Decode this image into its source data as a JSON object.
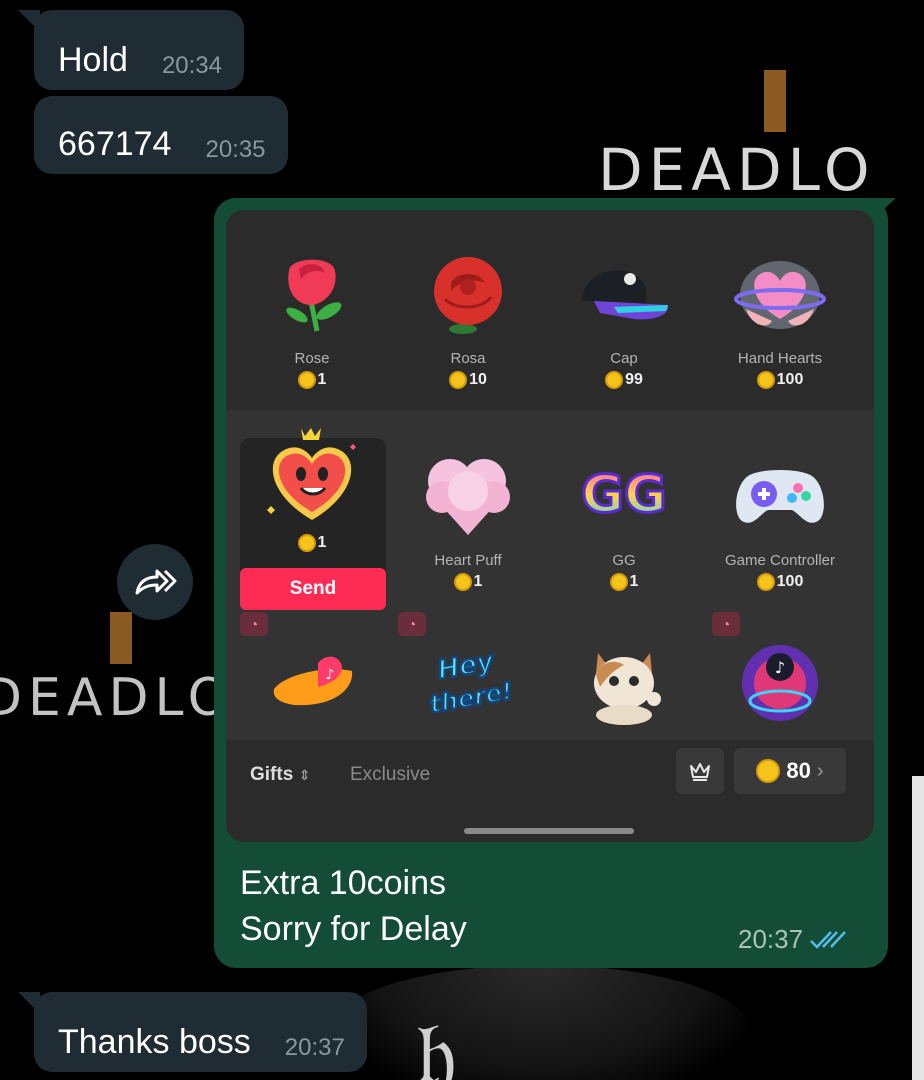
{
  "wallpaper": {
    "logo_text": "DEADLO"
  },
  "messages_in": [
    {
      "text": "Hold",
      "time": "20:34"
    },
    {
      "text": "667174",
      "time": "20:35"
    },
    {
      "text": "Thanks boss",
      "time": "20:37"
    }
  ],
  "outgoing": {
    "caption_line1": "Extra 10coins",
    "caption_line2": "Sorry for Delay",
    "time": "20:37",
    "status_icon": "double-check-icon"
  },
  "gift_panel": {
    "row1": [
      {
        "name": "Rose",
        "price": "1",
        "icon": "rose-icon"
      },
      {
        "name": "Rosa",
        "price": "10",
        "icon": "rosa-icon"
      },
      {
        "name": "Cap",
        "price": "99",
        "icon": "cap-icon"
      },
      {
        "name": "Hand Hearts",
        "price": "100",
        "icon": "hand-hearts-icon"
      }
    ],
    "row2": [
      {
        "name": "",
        "price": "1",
        "icon": "heart-me-icon",
        "selected": true
      },
      {
        "name": "Heart Puff",
        "price": "1",
        "icon": "heart-puff-icon"
      },
      {
        "name": "GG",
        "price": "1",
        "icon": "gg-icon"
      },
      {
        "name": "Game Controller",
        "price": "100",
        "icon": "game-controller-icon"
      }
    ],
    "row3_icons": [
      "tiktok-hand-icon",
      "hey-there-icon",
      "cat-icon",
      "tiktok-disco-icon"
    ],
    "send_label": "Send",
    "tabs": {
      "gifts": "Gifts",
      "exclusive": "Exclusive"
    },
    "balance": "80",
    "colors": {
      "send": "#fe2c55",
      "coin": "#f4c41b"
    }
  },
  "colors": {
    "incoming_bubble": "#1f2c33",
    "outgoing_bubble": "#144d37"
  }
}
